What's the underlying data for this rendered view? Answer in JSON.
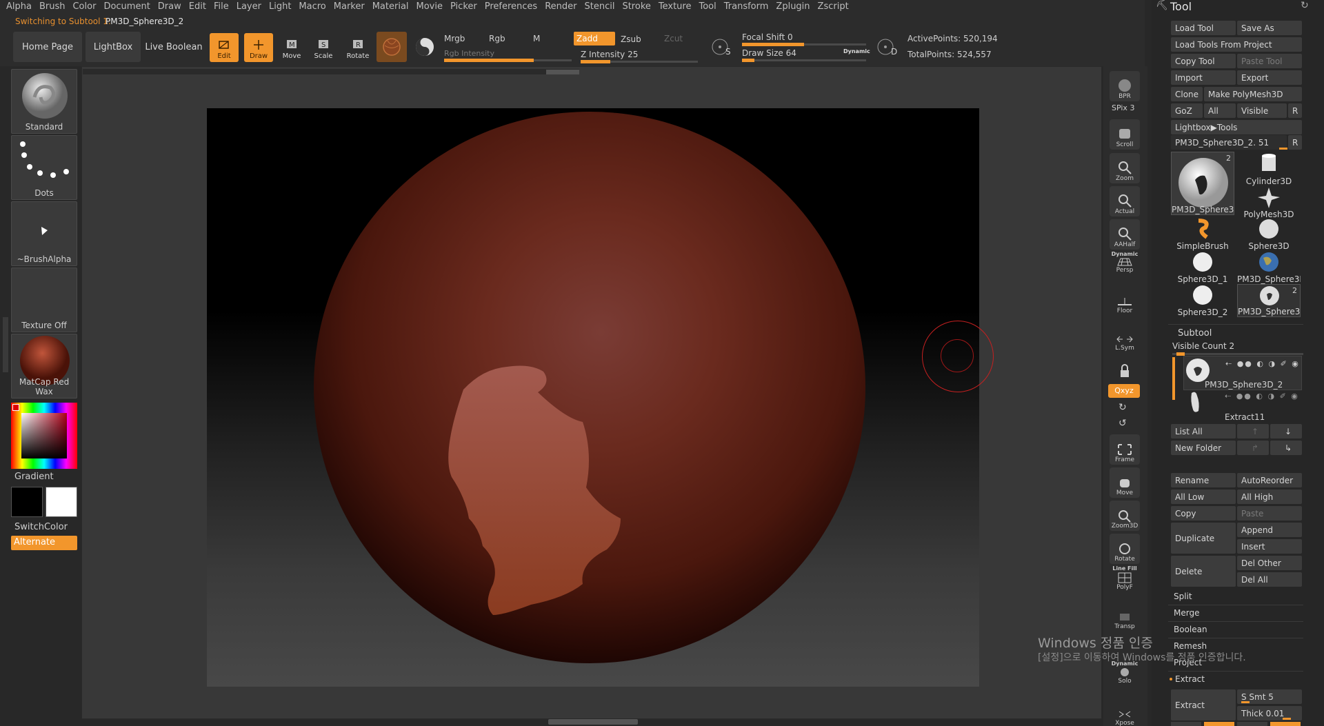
{
  "menu": [
    "Alpha",
    "Brush",
    "Color",
    "Document",
    "Draw",
    "Edit",
    "File",
    "Layer",
    "Light",
    "Macro",
    "Marker",
    "Material",
    "Movie",
    "Picker",
    "Preferences",
    "Render",
    "Stencil",
    "Stroke",
    "Texture",
    "Tool",
    "Transform",
    "Zplugin",
    "Zscript"
  ],
  "status": {
    "prefix": "Switching to Subtool 1:",
    "name": "PM3D_Sphere3D_2"
  },
  "nav": {
    "home": "Home Page",
    "lightbox": "LightBox",
    "liveboolean": "Live Boolean"
  },
  "transform_tools": {
    "edit": "Edit",
    "draw": "Draw",
    "move": "Move",
    "scale": "Scale",
    "rotate": "Rotate"
  },
  "color_mode": {
    "mrgb": "Mrgb",
    "rgb": "Rgb",
    "m": "M",
    "rgb_intensity": "Rgb Intensity",
    "rgb_intensity_value": 0.7
  },
  "sculpt_mode": {
    "zadd": "Zadd",
    "zsub": "Zsub",
    "zcut": "Zcut",
    "z_intensity_label": "Z Intensity",
    "z_intensity": "25",
    "z_intensity_value": 0.25
  },
  "stroke": {
    "s_label": "S",
    "d_label": "D",
    "focal_label": "Focal Shift",
    "focal_value": "0",
    "focal_fill": 0.5,
    "drawsize_label": "Draw Size",
    "drawsize_value": "64",
    "drawsize_fill": 0.1,
    "dynamic": "Dynamic"
  },
  "points": {
    "active_label": "ActivePoints:",
    "active": "520,194",
    "total_label": "TotalPoints:",
    "total": "524,557"
  },
  "left": {
    "brush": "Standard",
    "stroke": "Dots",
    "alpha": "~BrushAlpha",
    "texture": "Texture Off",
    "material": "MatCap Red Wax",
    "gradient": "Gradient",
    "switchcolor": "SwitchColor",
    "alternate": "Alternate"
  },
  "dock": {
    "bpr": "BPR",
    "spix_label": "SPix",
    "spix": "3",
    "scroll": "Scroll",
    "zoom": "Zoom",
    "actual": "Actual",
    "aahalf": "AAHalf",
    "dynamic": "Dynamic",
    "persp": "Persp",
    "floor": "Floor",
    "lsym": "L.Sym",
    "xyz": "Qxyz",
    "frame": "Frame",
    "move": "Move",
    "zoom3d": "Zoom3D",
    "rotate": "Rotate",
    "linefill": "Line Fill",
    "polyf": "PolyF",
    "transp": "Transp",
    "dynamic2": "Dynamic",
    "solo": "Solo",
    "xpose": "Xpose"
  },
  "tool": {
    "title": "Tool",
    "load": "Load Tool",
    "saveas": "Save As",
    "loadproj": "Load Tools From Project",
    "copy": "Copy Tool",
    "paste": "Paste Tool",
    "import": "Import",
    "export": "Export",
    "clone": "Clone",
    "makepoly": "Make PolyMesh3D",
    "goz": "GoZ",
    "all": "All",
    "visible": "Visible",
    "r": "R",
    "lightbox_tools": "Lightbox▶Tools",
    "current": "PM3D_Sphere3D_2. 51",
    "items": [
      "PM3D_Sphere3D",
      "Cylinder3D",
      "PolyMesh3D",
      "SimpleBrush",
      "Sphere3D",
      "Sphere3D_1",
      "PM3D_Sphere3D",
      "Sphere3D_2",
      "PM3D_Sphere3D"
    ],
    "badges": [
      "2",
      "2"
    ]
  },
  "subtool": {
    "title": "Subtool",
    "visible_count": "Visible Count 2",
    "items": [
      "PM3D_Sphere3D_2",
      "Extract11"
    ],
    "listall": "List All",
    "newfolder": "New Folder",
    "rename": "Rename",
    "autoreorder": "AutoReorder",
    "alllow": "All Low",
    "allhigh": "All High",
    "copy": "Copy",
    "paste": "Paste",
    "duplicate": "Duplicate",
    "append": "Append",
    "insert": "Insert",
    "delete": "Delete",
    "delother": "Del Other",
    "delall": "Del All",
    "split": "Split",
    "merge": "Merge",
    "boolean": "Boolean",
    "remesh": "Remesh",
    "project": "Project",
    "extract_section": "Extract",
    "extract_btn": "Extract",
    "ssmt_label": "S Smt",
    "ssmt": "5",
    "thick_label": "Thick",
    "thick": "0.01"
  },
  "watermark": {
    "line1": "Windows 정품 인증",
    "line2": "[설정]으로 이동하여 Windows를 정품 인증합니다."
  },
  "colors": {
    "accent": "#f2962c",
    "panel": "#2c2c2c",
    "sphere": "#8a3320"
  }
}
